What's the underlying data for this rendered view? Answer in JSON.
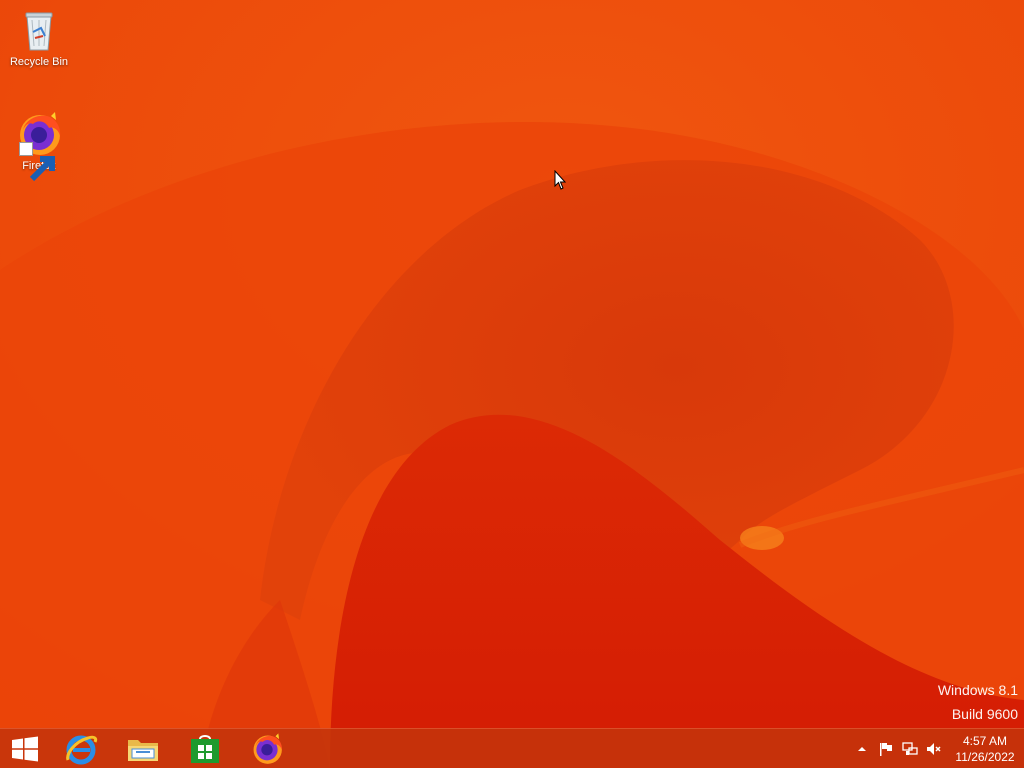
{
  "desktop": {
    "icons": [
      {
        "label": "Recycle Bin",
        "icon": "recycle-bin-icon"
      },
      {
        "label": "Firefox",
        "icon": "firefox-icon"
      }
    ]
  },
  "watermark": {
    "line1": "Windows 8.1",
    "line2": "Build 9600"
  },
  "taskbar": {
    "pinned": [
      {
        "name": "start-button",
        "icon": "windows-logo-icon"
      },
      {
        "name": "internet-explorer",
        "icon": "internet-explorer-icon"
      },
      {
        "name": "file-explorer",
        "icon": "file-explorer-icon"
      },
      {
        "name": "store",
        "icon": "store-icon"
      },
      {
        "name": "firefox",
        "icon": "firefox-icon"
      }
    ],
    "tray": {
      "icons": [
        "show-hidden-icons-icon",
        "action-center-flag-icon",
        "network-icon",
        "volume-muted-icon"
      ],
      "time": "4:57 AM",
      "date": "11/26/2022"
    }
  },
  "colors": {
    "wallpaper_base": "#ee4a0c",
    "wallpaper_dark": "#d81f05",
    "taskbar": "#c4340c",
    "store_green": "#1e9a2e"
  }
}
